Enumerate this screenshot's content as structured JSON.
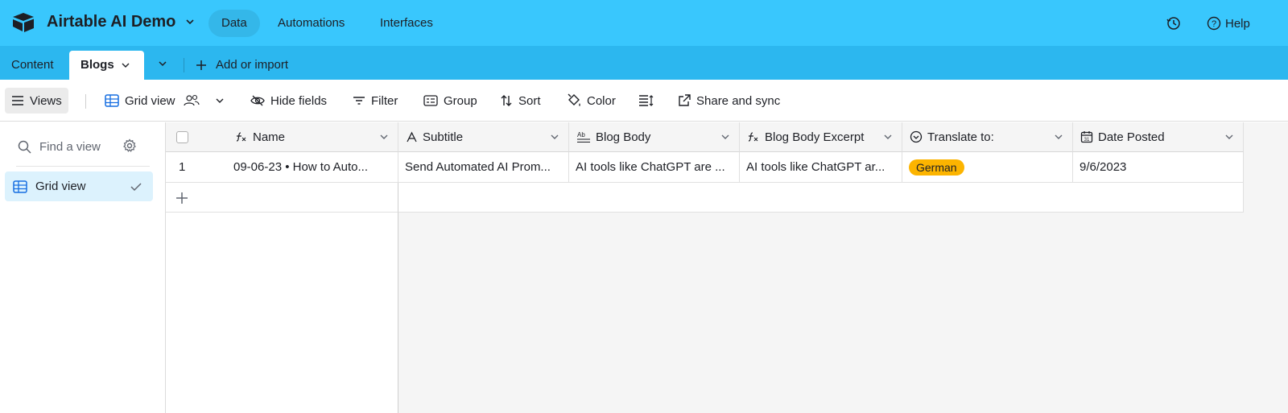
{
  "header": {
    "base_title": "Airtable AI Demo",
    "nav": [
      "Data",
      "Automations",
      "Interfaces"
    ],
    "active_nav": "Data",
    "help_label": "Help"
  },
  "tabs": {
    "items": [
      "Content",
      "Blogs"
    ],
    "active": "Blogs",
    "add_label": "Add or import"
  },
  "toolbar": {
    "views_label": "Views",
    "view_name": "Grid view",
    "hide_fields": "Hide fields",
    "filter": "Filter",
    "group": "Group",
    "sort": "Sort",
    "color": "Color",
    "share": "Share and sync"
  },
  "sidebar": {
    "find_placeholder": "Find a view",
    "views": [
      "Grid view"
    ]
  },
  "table": {
    "columns": [
      {
        "name": "Name",
        "icon": "formula-icon"
      },
      {
        "name": "Subtitle",
        "icon": "text-icon"
      },
      {
        "name": "Blog Body",
        "icon": "long-text-icon"
      },
      {
        "name": "Blog Body Excerpt",
        "icon": "formula-icon"
      },
      {
        "name": "Translate to:",
        "icon": "single-select-icon"
      },
      {
        "name": "Date Posted",
        "icon": "calendar-icon"
      }
    ],
    "rows": [
      {
        "num": "1",
        "name": "09-06-23 • How to Auto...",
        "subtitle": "Send Automated AI Prom...",
        "blog_body": "AI tools like ChatGPT are ...",
        "excerpt": "AI tools like ChatGPT ar...",
        "translate": "German",
        "date": "9/6/2023"
      }
    ]
  },
  "colors": {
    "header_bg": "#39c7fd",
    "tabbar_bg": "#2cb7ef",
    "pill": "#fcb400",
    "selected_view": "#dcf2fd"
  }
}
